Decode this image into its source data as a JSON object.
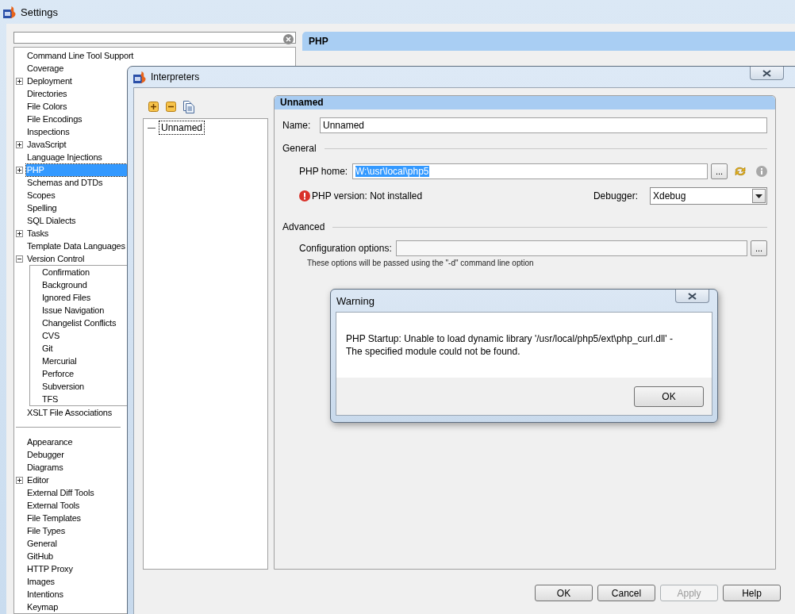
{
  "settings_window": {
    "title": "Settings",
    "tree": [
      {
        "label": "Command Line Tool Support"
      },
      {
        "label": "Coverage"
      },
      {
        "label": "Deployment",
        "expanded": false
      },
      {
        "label": "Directories"
      },
      {
        "label": "File Colors"
      },
      {
        "label": "File Encodings"
      },
      {
        "label": "Inspections"
      },
      {
        "label": "JavaScript",
        "expanded": false
      },
      {
        "label": "Language Injections"
      },
      {
        "label": "PHP",
        "expanded": false,
        "selected": true
      },
      {
        "label": "Schemas and DTDs"
      },
      {
        "label": "Scopes"
      },
      {
        "label": "Spelling"
      },
      {
        "label": "SQL Dialects"
      },
      {
        "label": "Tasks",
        "expanded": false
      },
      {
        "label": "Template Data Languages"
      },
      {
        "label": "Version Control",
        "expanded": true,
        "children": [
          {
            "label": "Confirmation"
          },
          {
            "label": "Background"
          },
          {
            "label": "Ignored Files"
          },
          {
            "label": "Issue Navigation"
          },
          {
            "label": "Changelist Conflicts"
          },
          {
            "label": "CVS"
          },
          {
            "label": "Git"
          },
          {
            "label": "Mercurial"
          },
          {
            "label": "Perforce"
          },
          {
            "label": "Subversion"
          },
          {
            "label": "TFS"
          }
        ]
      },
      {
        "label": "XSLT File Associations"
      }
    ],
    "tree_2": [
      {
        "label": "Appearance"
      },
      {
        "label": "Debugger"
      },
      {
        "label": "Diagrams"
      },
      {
        "label": "Editor",
        "expanded": false
      },
      {
        "label": "External Diff Tools"
      },
      {
        "label": "External Tools"
      },
      {
        "label": "File Templates"
      },
      {
        "label": "File Types"
      },
      {
        "label": "General"
      },
      {
        "label": "GitHub"
      },
      {
        "label": "HTTP Proxy"
      },
      {
        "label": "Images"
      },
      {
        "label": "Intentions"
      },
      {
        "label": "Keymap"
      }
    ],
    "panel": {
      "title": "PHP"
    }
  },
  "interpreters_dialog": {
    "title": "Interpreters",
    "interpreters": [
      {
        "label": "Unnamed",
        "selected": true
      }
    ],
    "details": {
      "header": "Unnamed",
      "name_label": "Name:",
      "name_value": "Unnamed",
      "general_heading": "General",
      "php_home_label": "PHP home:",
      "php_home_value": "W:\\usr\\local\\php5",
      "php_home_highlighted": true,
      "browse_button": "...",
      "version_status": "PHP version: Not installed",
      "debugger_label": "Debugger:",
      "debugger_value": "Xdebug",
      "advanced_heading": "Advanced",
      "config_label": "Configuration options:",
      "config_browse_button": "...",
      "config_hint": "These options will be passed using the \"-d\" command line option"
    },
    "buttons": [
      {
        "label": "OK",
        "disabled": false
      },
      {
        "label": "Cancel",
        "disabled": false
      },
      {
        "label": "Apply",
        "disabled": true
      },
      {
        "label": "Help",
        "disabled": false
      }
    ]
  },
  "warning_dialog": {
    "title": "Warning",
    "message": "PHP Startup: Unable to load dynamic library '/usr/local/php5/ext\\php_curl.dll' -\nThe specified module could not be found.",
    "ok_button": "OK"
  }
}
